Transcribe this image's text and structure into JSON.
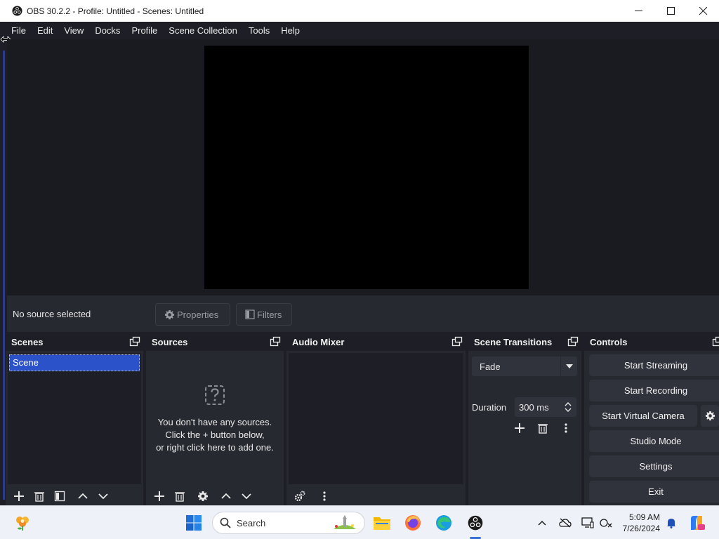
{
  "window": {
    "title": "OBS 30.2.2 - Profile: Untitled - Scenes: Untitled"
  },
  "menu": [
    "File",
    "Edit",
    "View",
    "Docks",
    "Profile",
    "Scene Collection",
    "Tools",
    "Help"
  ],
  "context_bar": {
    "status": "No source selected",
    "properties_label": "Properties",
    "filters_label": "Filters"
  },
  "docks": {
    "scenes": {
      "title": "Scenes",
      "items": [
        "Scene"
      ]
    },
    "sources": {
      "title": "Sources",
      "empty_line1": "You don't have any sources.",
      "empty_line2": "Click the + button below,",
      "empty_line3": "or right click here to add one."
    },
    "audio_mixer": {
      "title": "Audio Mixer"
    },
    "scene_transitions": {
      "title": "Scene Transitions",
      "selected_transition": "Fade",
      "duration_label": "Duration",
      "duration_value": "300 ms"
    },
    "controls": {
      "title": "Controls",
      "start_streaming": "Start Streaming",
      "start_recording": "Start Recording",
      "start_virtual_camera": "Start Virtual Camera",
      "studio_mode": "Studio Mode",
      "settings": "Settings",
      "exit": "Exit"
    }
  },
  "taskbar": {
    "search_label": "Search",
    "time": "5:09 AM",
    "date": "7/26/2024"
  },
  "colors": {
    "background": "#1e1f26",
    "dock_background": "#272931",
    "button": "#31333c",
    "scene_selected": "#2b52c9",
    "preview": "#000000"
  }
}
